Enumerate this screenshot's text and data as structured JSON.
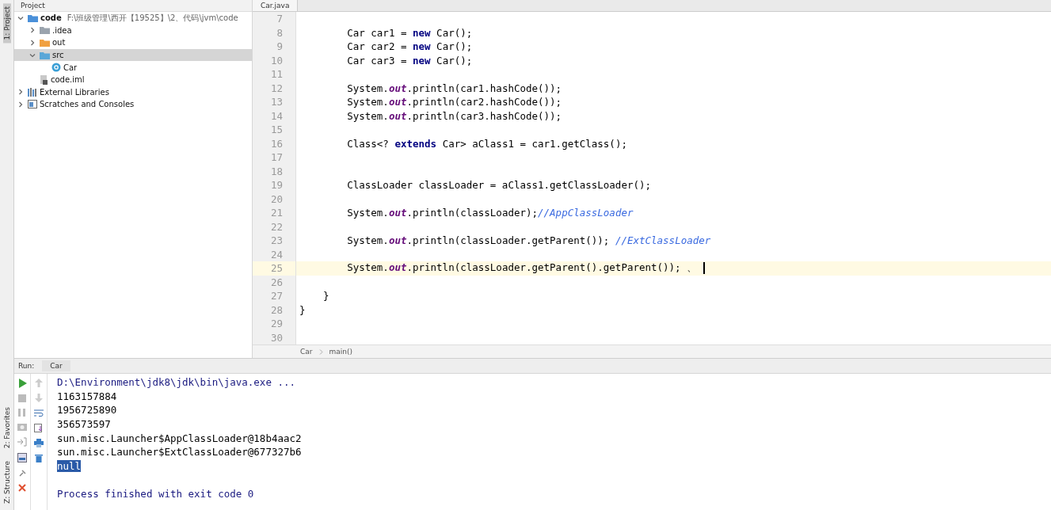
{
  "side_tabs": [
    {
      "label": "1: Project",
      "selected": true
    },
    {
      "label": "2: Favorites",
      "selected": false
    },
    {
      "label": "Z: Structure",
      "selected": false
    }
  ],
  "project": {
    "title": "Project",
    "tree": [
      {
        "label": "code",
        "path": "F:\\班级管理\\西开【19525】\\2、代码\\jvm\\code",
        "kind": "module",
        "expanded": true,
        "selected": false,
        "children": [
          {
            "label": ".idea",
            "kind": "folder",
            "expanded": false,
            "selected": false
          },
          {
            "label": "out",
            "kind": "excluded",
            "expanded": false,
            "selected": false
          },
          {
            "label": "src",
            "kind": "source",
            "expanded": true,
            "selected": true,
            "children": [
              {
                "label": "Car",
                "kind": "class",
                "selected": false
              }
            ]
          },
          {
            "label": "code.iml",
            "kind": "file",
            "selected": false
          }
        ]
      },
      {
        "label": "External Libraries",
        "kind": "libraries",
        "expanded": false,
        "selected": false
      },
      {
        "label": "Scratches and Consoles",
        "kind": "scratches",
        "expanded": false,
        "selected": false
      }
    ]
  },
  "editor": {
    "tab": "Car.java",
    "lines": [
      {
        "n": "7"
      },
      {
        "n": "8",
        "segs": [
          {
            "t": "        Car car1 = ",
            "kind": "plain"
          },
          {
            "t": "new",
            "kind": "keyword"
          },
          {
            "t": " Car();",
            "kind": "plain"
          }
        ]
      },
      {
        "n": "9",
        "segs": [
          {
            "t": "        Car car2 = ",
            "kind": "plain"
          },
          {
            "t": "new",
            "kind": "keyword"
          },
          {
            "t": " Car();",
            "kind": "plain"
          }
        ]
      },
      {
        "n": "10",
        "segs": [
          {
            "t": "        Car car3 = ",
            "kind": "plain"
          },
          {
            "t": "new",
            "kind": "keyword"
          },
          {
            "t": " Car();",
            "kind": "plain"
          }
        ]
      },
      {
        "n": "11"
      },
      {
        "n": "12",
        "segs": [
          {
            "t": "        System.",
            "kind": "plain"
          },
          {
            "t": "out",
            "kind": "field"
          },
          {
            "t": ".println(car1.hashCode());",
            "kind": "plain"
          }
        ]
      },
      {
        "n": "13",
        "segs": [
          {
            "t": "        System.",
            "kind": "plain"
          },
          {
            "t": "out",
            "kind": "field"
          },
          {
            "t": ".println(car2.hashCode());",
            "kind": "plain"
          }
        ]
      },
      {
        "n": "14",
        "segs": [
          {
            "t": "        System.",
            "kind": "plain"
          },
          {
            "t": "out",
            "kind": "field"
          },
          {
            "t": ".println(car3.hashCode());",
            "kind": "plain"
          }
        ]
      },
      {
        "n": "15"
      },
      {
        "n": "16",
        "segs": [
          {
            "t": "        Class<? ",
            "kind": "plain"
          },
          {
            "t": "extends",
            "kind": "keyword"
          },
          {
            "t": " Car> aClass1 = car1.getClass();",
            "kind": "plain"
          }
        ]
      },
      {
        "n": "17"
      },
      {
        "n": "18"
      },
      {
        "n": "19",
        "segs": [
          {
            "t": "        ClassLoader classLoader = aClass1.getClassLoader();",
            "kind": "plain"
          }
        ]
      },
      {
        "n": "20"
      },
      {
        "n": "21",
        "segs": [
          {
            "t": "        System.",
            "kind": "plain"
          },
          {
            "t": "out",
            "kind": "field"
          },
          {
            "t": ".println(classLoader);",
            "kind": "plain"
          },
          {
            "t": "//AppClassLoader",
            "kind": "comment"
          }
        ]
      },
      {
        "n": "22"
      },
      {
        "n": "23",
        "segs": [
          {
            "t": "        System.",
            "kind": "plain"
          },
          {
            "t": "out",
            "kind": "field"
          },
          {
            "t": ".println(classLoader.getParent()); ",
            "kind": "plain"
          },
          {
            "t": "//ExtClassLoader",
            "kind": "comment"
          }
        ]
      },
      {
        "n": "24"
      },
      {
        "n": "25",
        "current": true,
        "caret": true,
        "segs": [
          {
            "t": "        System.",
            "kind": "plain"
          },
          {
            "t": "out",
            "kind": "field"
          },
          {
            "t": ".println(classLoader.getParent().getParent()); 、",
            "kind": "plain"
          }
        ]
      },
      {
        "n": "26"
      },
      {
        "n": "27",
        "segs": [
          {
            "t": "    }",
            "kind": "plain"
          }
        ]
      },
      {
        "n": "28",
        "segs": [
          {
            "t": "}",
            "kind": "plain"
          }
        ]
      },
      {
        "n": "29"
      },
      {
        "n": "30"
      }
    ],
    "breadcrumbs": [
      "Car",
      "main()"
    ]
  },
  "run": {
    "label": "Run:",
    "tab": "Car",
    "output": [
      {
        "t": "D:\\Environment\\jdk8\\jdk\\bin\\java.exe ...",
        "kind": "command"
      },
      {
        "t": "1163157884",
        "kind": "out"
      },
      {
        "t": "1956725890",
        "kind": "out"
      },
      {
        "t": "356573597",
        "kind": "out"
      },
      {
        "t": "sun.misc.Launcher$AppClassLoader@18b4aac2",
        "kind": "out"
      },
      {
        "t": "sun.misc.Launcher$ExtClassLoader@677327b6",
        "kind": "out"
      },
      {
        "t": "null",
        "kind": "selected"
      },
      {
        "kind": "blank"
      },
      {
        "t": "Process finished with exit code 0",
        "kind": "status"
      }
    ]
  }
}
